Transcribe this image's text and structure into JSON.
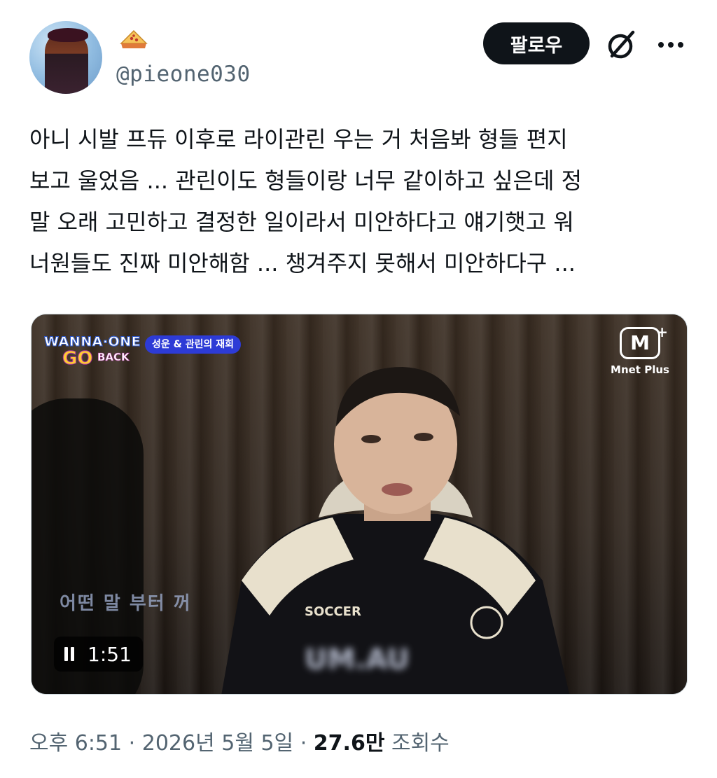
{
  "author": {
    "handle": "@pieone030",
    "name_emoji": "pie-emoji"
  },
  "header": {
    "follow_label": "팔로우",
    "grok_icon": "grok-icon",
    "more_icon": "more-icon"
  },
  "tweet": {
    "lines": [
      "아니 시발 프듀 이후로 라이관린 우는 거 처음봐 형들 편지",
      "보고 울었음 ... 관린이도 형들이랑 너무 같이하고 싶은데 정",
      "말 오래 고민하고 결정한 일이라서 미안하다고 얘기햇고 워",
      "너원들도 진짜 미안해함 ... 챙겨주지 못해서 미안하다구 ..."
    ]
  },
  "video": {
    "show_logo_line1": "WANNA·ONE",
    "show_logo_line2": "GO",
    "show_logo_line3": "BACK",
    "episode_badge": "성운 & 관린의 재회",
    "channel_name": "Mnet Plus",
    "channel_mark": "M",
    "subtitle": "어떤 말 부터 꺼",
    "blurred_logo": "UM.AU",
    "duration": "1:51",
    "paused": false
  },
  "meta": {
    "time": "오후 6:51",
    "separator": "·",
    "date": "2026년 5월 5일",
    "views_count": "27.6만",
    "views_label": "조회수"
  },
  "colors": {
    "text_primary": "#0f1419",
    "text_secondary": "#536471",
    "follow_bg": "#0f1419",
    "border": "#cfd9de"
  }
}
